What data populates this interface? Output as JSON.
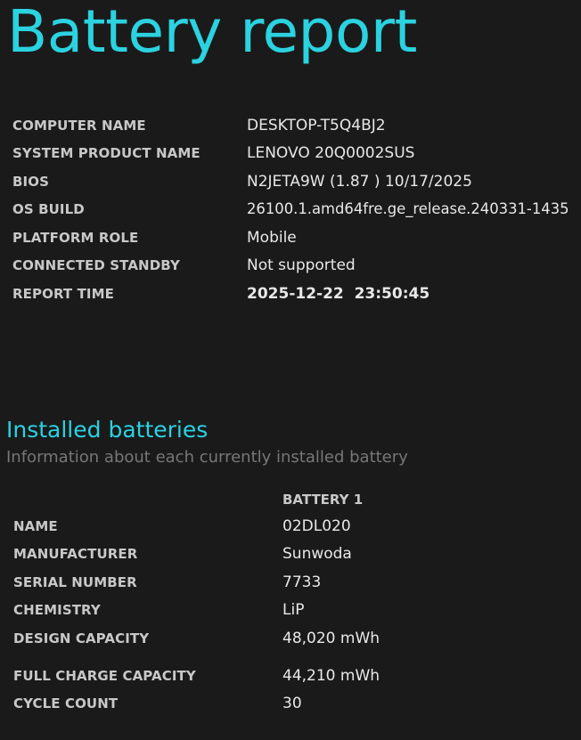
{
  "report": {
    "title": "Battery report"
  },
  "system_info": [
    {
      "label": "COMPUTER NAME",
      "value": "DESKTOP-T5Q4BJ2"
    },
    {
      "label": "SYSTEM PRODUCT NAME",
      "value": "LENOVO 20Q0002SUS"
    },
    {
      "label": "BIOS",
      "value": "N2JETA9W (1.87 ) 10/17/2025"
    },
    {
      "label": "OS BUILD",
      "value": "26100.1.amd64fre.ge_release.240331-1435"
    },
    {
      "label": "PLATFORM ROLE",
      "value": "Mobile"
    },
    {
      "label": "CONNECTED STANDBY",
      "value": "Not supported"
    },
    {
      "label": "REPORT TIME",
      "value": "2025-12-22  23:50:45"
    }
  ],
  "installed_batteries": {
    "title": "Installed batteries",
    "subtitle": "Information about each currently installed battery",
    "column_header": "BATTERY 1",
    "rows": [
      {
        "label": "NAME",
        "value": "02DL020"
      },
      {
        "label": "MANUFACTURER",
        "value": "Sunwoda"
      },
      {
        "label": "SERIAL NUMBER",
        "value": "7733"
      },
      {
        "label": "CHEMISTRY",
        "value": "LiP"
      },
      {
        "label": "DESIGN CAPACITY",
        "value": "48,020 mWh"
      },
      {
        "label": "FULL CHARGE CAPACITY",
        "value": "44,210 mWh"
      },
      {
        "label": "CYCLE COUNT",
        "value": "30"
      }
    ]
  },
  "colors": {
    "background": "#1a1a1a",
    "accent": "#2bd2e0",
    "label": "#c8c8c8",
    "value": "#e8e8e8",
    "subtitle": "#777777"
  }
}
